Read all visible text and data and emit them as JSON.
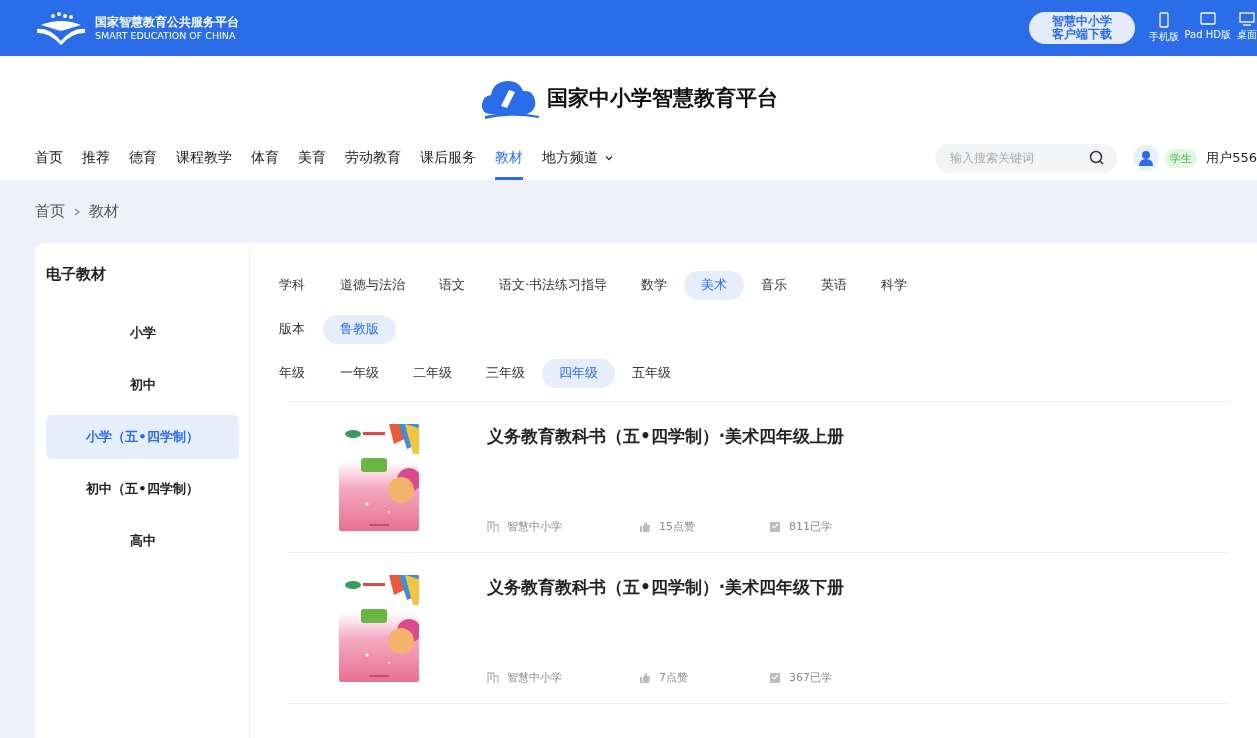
{
  "topbar": {
    "logo_title": "国家智慧教育公共服务平台",
    "logo_subtitle": "SMART EDUCATION OF CHINA",
    "download_button": [
      "智慧中小学",
      "客户端下载"
    ],
    "devices": [
      {
        "kind": "phone",
        "label": "手机版"
      },
      {
        "kind": "tablet",
        "label": "Pad HD版"
      },
      {
        "kind": "desktop",
        "label": "桌面"
      }
    ]
  },
  "brand": {
    "title": "国家中小学智慧教育平台"
  },
  "nav": {
    "items": [
      {
        "label": "首页",
        "selected": false,
        "dropdown": false
      },
      {
        "label": "推荐",
        "selected": false,
        "dropdown": false
      },
      {
        "label": "德育",
        "selected": false,
        "dropdown": false
      },
      {
        "label": "课程教学",
        "selected": false,
        "dropdown": false
      },
      {
        "label": "体育",
        "selected": false,
        "dropdown": false
      },
      {
        "label": "美育",
        "selected": false,
        "dropdown": false
      },
      {
        "label": "劳动教育",
        "selected": false,
        "dropdown": false
      },
      {
        "label": "课后服务",
        "selected": false,
        "dropdown": false
      },
      {
        "label": "教材",
        "selected": true,
        "dropdown": false
      },
      {
        "label": "地方频道",
        "selected": false,
        "dropdown": true
      }
    ],
    "search": {
      "placeholder": "输入搜索关键词"
    },
    "role_badge": "学生",
    "user": "用户556"
  },
  "breadcrumb": [
    "首页",
    "教材"
  ],
  "sidebar": {
    "title": "电子教材",
    "items": [
      {
        "label": "小学",
        "selected": false
      },
      {
        "label": "初中",
        "selected": false
      },
      {
        "label": "小学（五•四学制）",
        "selected": true
      },
      {
        "label": "初中（五•四学制）",
        "selected": false
      },
      {
        "label": "高中",
        "selected": false
      }
    ]
  },
  "filters": [
    {
      "label": "学科",
      "options": [
        {
          "label": "道德与法治",
          "selected": false
        },
        {
          "label": "语文",
          "selected": false
        },
        {
          "label": "语文·书法练习指导",
          "selected": false
        },
        {
          "label": "数学",
          "selected": false
        },
        {
          "label": "美术",
          "selected": true
        },
        {
          "label": "音乐",
          "selected": false
        },
        {
          "label": "英语",
          "selected": false
        },
        {
          "label": "科学",
          "selected": false
        }
      ]
    },
    {
      "label": "版本",
      "options": [
        {
          "label": "鲁教版",
          "selected": true
        }
      ]
    },
    {
      "label": "年级",
      "options": [
        {
          "label": "一年级",
          "selected": false
        },
        {
          "label": "二年级",
          "selected": false
        },
        {
          "label": "三年级",
          "selected": false
        },
        {
          "label": "四年级",
          "selected": true
        },
        {
          "label": "五年级",
          "selected": false
        }
      ]
    }
  ],
  "books": [
    {
      "title": "义务教育教科书（五•四学制）·美术四年级上册",
      "publisher": "智慧中小学",
      "likes": "15点赞",
      "learners": "811已学"
    },
    {
      "title": "义务教育教科书（五•四学制）·美术四年级下册",
      "publisher": "智慧中小学",
      "likes": "7点赞",
      "learners": "367已学"
    }
  ]
}
